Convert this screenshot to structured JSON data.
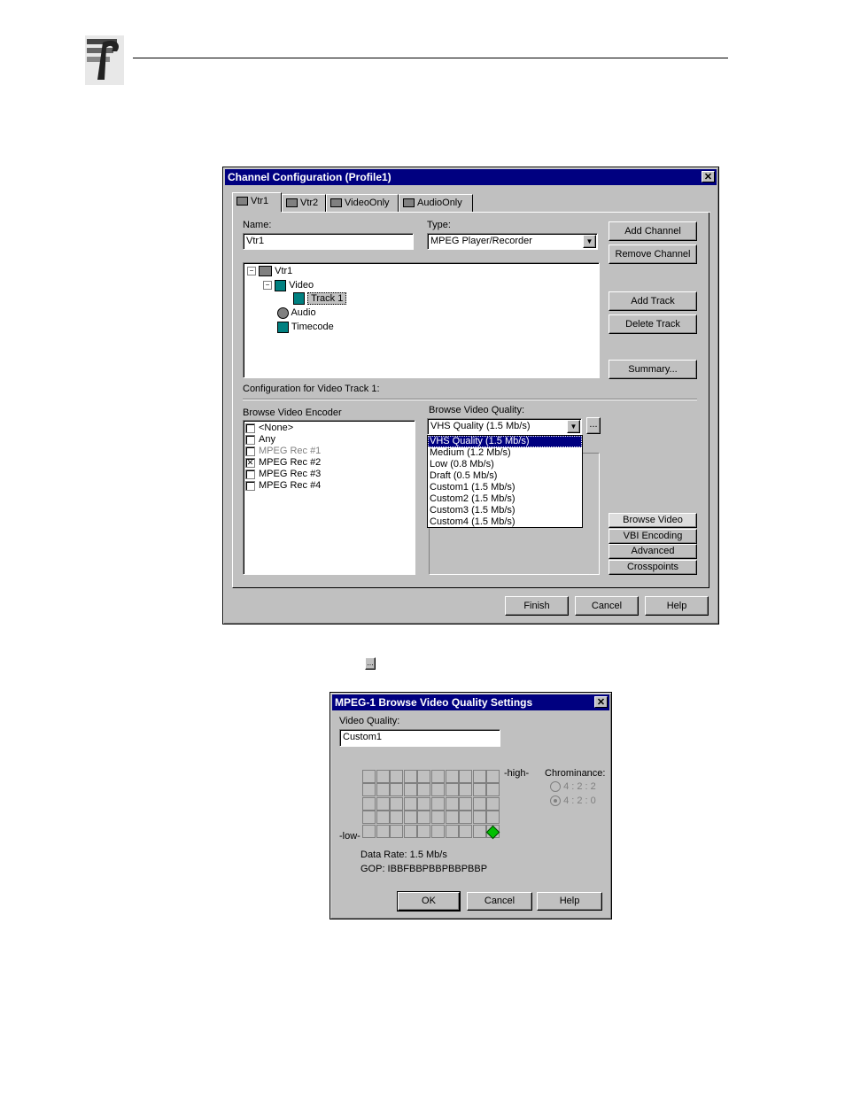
{
  "dialog1": {
    "title": "Channel Configuration (Profile1)",
    "tabs": [
      "Vtr1",
      "Vtr2",
      "VideoOnly",
      "AudioOnly"
    ],
    "name_label": "Name:",
    "name_value": "Vtr1",
    "type_label": "Type:",
    "type_value": "MPEG Player/Recorder",
    "tree": {
      "root": "Vtr1",
      "video": "Video",
      "track": "Track 1",
      "audio": "Audio",
      "timecode": "Timecode"
    },
    "buttons": {
      "add_channel": "Add Channel",
      "remove_channel": "Remove Channel",
      "add_track": "Add Track",
      "delete_track": "Delete Track",
      "summary": "Summary...",
      "browse_video": "Browse Video",
      "vbi_encoding": "VBI Encoding",
      "advanced": "Advanced",
      "crosspoints": "Crosspoints",
      "finish": "Finish",
      "cancel": "Cancel",
      "help": "Help",
      "ellipsis": "..."
    },
    "config_label": "Configuration for Video Track 1:",
    "encoder_label": "Browse Video Encoder",
    "encoders": [
      {
        "label": "<None>",
        "checked": false,
        "disabled": false
      },
      {
        "label": "Any",
        "checked": false,
        "disabled": false
      },
      {
        "label": "MPEG Rec #1",
        "checked": false,
        "disabled": true
      },
      {
        "label": "MPEG Rec #2",
        "checked": true,
        "disabled": false
      },
      {
        "label": "MPEG Rec #3",
        "checked": false,
        "disabled": false
      },
      {
        "label": "MPEG Rec #4",
        "checked": false,
        "disabled": false
      }
    ],
    "quality_label": "Browse Video Quality:",
    "quality_value": "VHS Quality (1.5 Mb/s)",
    "quality_options": [
      "VHS Quality (1.5 Mb/s)",
      "Medium (1.2 Mb/s)",
      "Low (0.8 Mb/s)",
      "Draft (0.5 Mb/s)",
      "Custom1 (1.5 Mb/s)",
      "Custom2 (1.5 Mb/s)",
      "Custom3 (1.5 Mb/s)",
      "Custom4 (1.5 Mb/s)"
    ]
  },
  "inline_button": "...",
  "dialog2": {
    "title": "MPEG-1 Browse Video Quality Settings",
    "quality_label": "Video Quality:",
    "quality_value": "Custom1",
    "high_label": "-high-",
    "low_label": "-low-",
    "chrominance_label": "Chrominance:",
    "chroma_options": [
      "4 : 2 : 2",
      "4 : 2 : 0"
    ],
    "chroma_selected": "4 : 2 : 0",
    "data_rate": "Data Rate: 1.5 Mb/s",
    "gop": "GOP:  IBBFBBPBBPBBPBBP",
    "buttons": {
      "ok": "OK",
      "cancel": "Cancel",
      "help": "Help"
    }
  },
  "colors": {
    "titlebar": "#000080",
    "face": "#c0c0c0",
    "marker": "#00c000"
  }
}
